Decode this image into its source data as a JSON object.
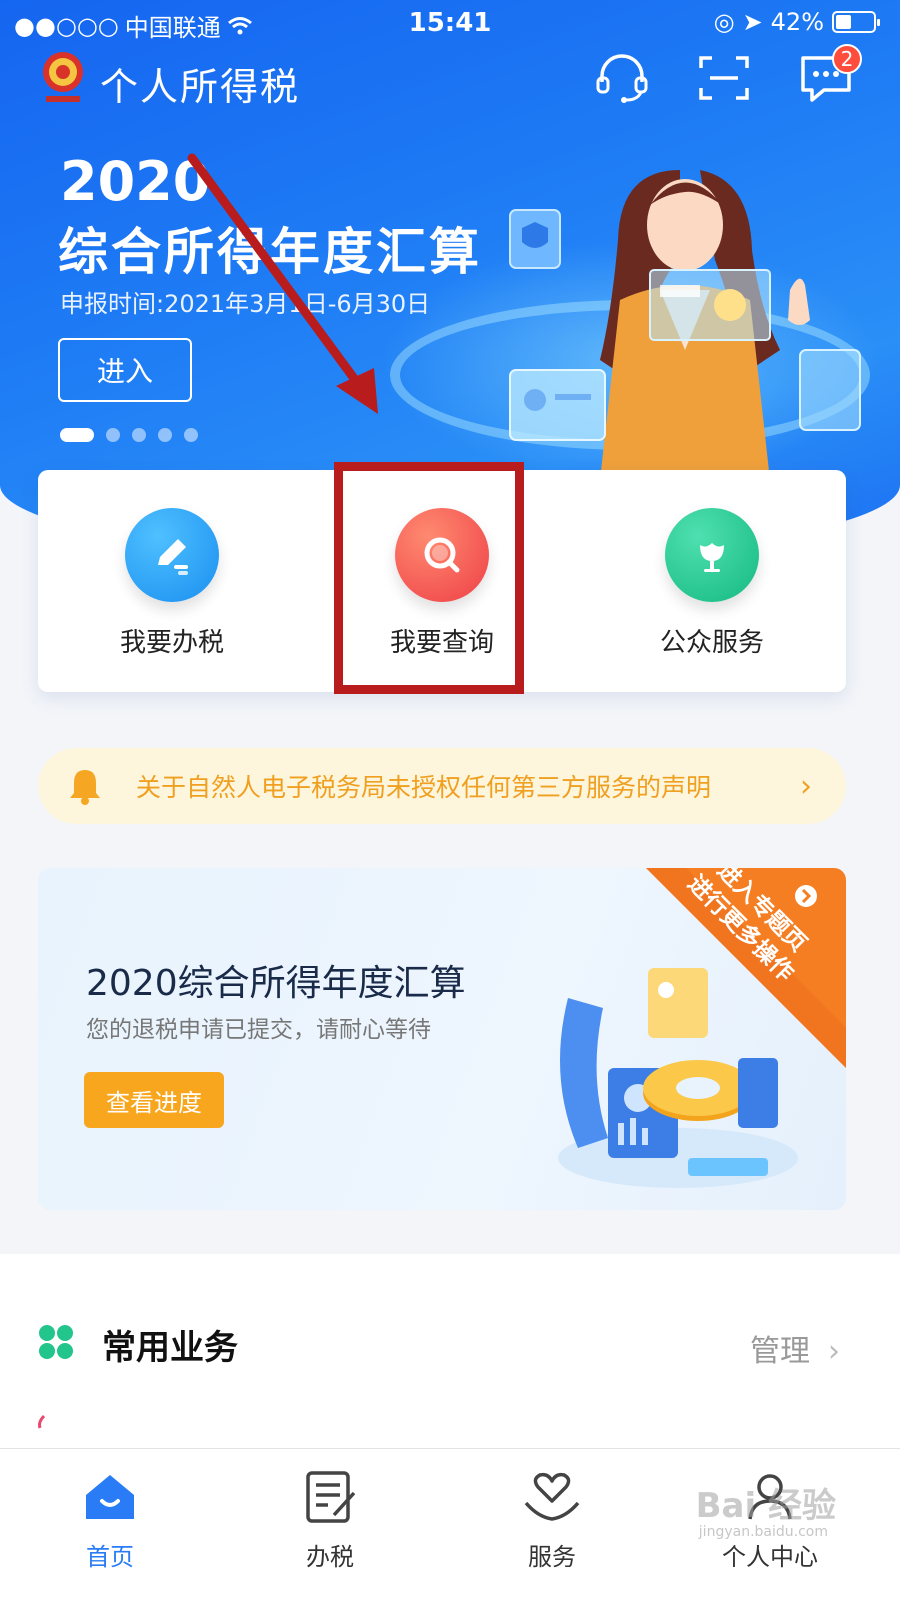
{
  "status_bar": {
    "carrier": "中国联通",
    "time": "15:41",
    "battery": "42%",
    "battery_level": 0.42
  },
  "header": {
    "title": "个人所得税",
    "message_badge": "2",
    "icons": [
      "headset-icon",
      "scan-icon",
      "message-icon"
    ]
  },
  "banner": {
    "year": "2020",
    "title": "综合所得年度汇算",
    "date": "申报时间:2021年3月1日-6月30日",
    "enter_button": "进入",
    "page_count": 5,
    "active_page": 1
  },
  "quick_actions": [
    {
      "label": "我要办税",
      "icon": "pencil-icon",
      "color": "#1fa2f5"
    },
    {
      "label": "我要查询",
      "icon": "magnifier-icon",
      "color": "#f0504a"
    },
    {
      "label": "公众服务",
      "icon": "flower-icon",
      "color": "#22c58c"
    }
  ],
  "notice": {
    "text": "关于自然人电子税务局未授权任何第三方服务的声明",
    "icon": "bell-icon"
  },
  "annual_card": {
    "title": "2020综合所得年度汇算",
    "subtitle": "您的退税申请已提交，请耐心等待",
    "button": "查看进度",
    "corner_line1": "进入专题页",
    "corner_line2": "进行更多操作"
  },
  "common_services": {
    "title": "常用业务",
    "manage": "管理"
  },
  "tabs": [
    {
      "label": "首页",
      "icon": "home-icon",
      "active": true
    },
    {
      "label": "办税",
      "icon": "form-icon",
      "active": false
    },
    {
      "label": "服务",
      "icon": "heart-hand-icon",
      "active": false
    },
    {
      "label": "个人中心",
      "icon": "person-icon",
      "active": false
    }
  ],
  "watermark": {
    "text": "Bai 经验",
    "sub": "jingyan.baidu.com"
  },
  "colors": {
    "brand_blue": "#1f7df5",
    "accent_orange": "#f7a61d",
    "highlight_red": "#b81c1c"
  }
}
